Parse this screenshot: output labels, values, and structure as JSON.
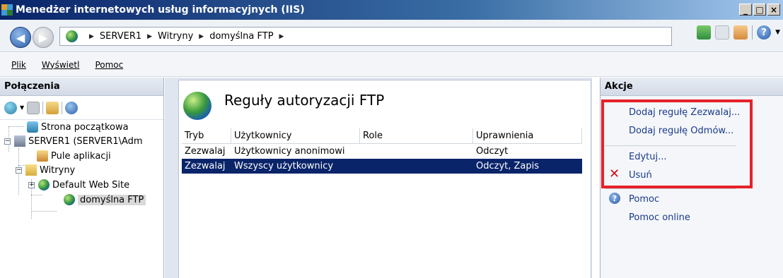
{
  "window": {
    "title": "Menedżer internetowych usług informacyjnych (IIS)",
    "buttons": [
      "_",
      "□",
      "×"
    ]
  },
  "address": {
    "breadcrumbs": [
      "SERVER1",
      "Witryny",
      "domyślna FTP"
    ]
  },
  "menu": {
    "items": [
      "Plik",
      "Wyświetl",
      "Pomoc"
    ]
  },
  "connections": {
    "header": "Połączenia",
    "tree": [
      {
        "label": "Strona początkowa",
        "icon": "home-icon"
      },
      {
        "label": "SERVER1 (SERVER1\\Adm",
        "icon": "server-icon",
        "expander": "−"
      },
      {
        "label": "Pule aplikacji",
        "icon": "app-pool-icon"
      },
      {
        "label": "Witryny",
        "icon": "folder-icon",
        "expander": "−"
      },
      {
        "label": "Default Web Site",
        "icon": "globe-icon",
        "expander": "+"
      },
      {
        "label": "domyślna FTP",
        "icon": "globe-icon",
        "selected": true
      }
    ]
  },
  "center": {
    "title": "Reguły autoryzacji FTP",
    "columns": [
      "Tryb",
      "Użytkownicy",
      "Role",
      "Uprawnienia"
    ],
    "rows": [
      {
        "tryb": "Zezwalaj",
        "uzytkownicy": "Użytkownicy anonimowi",
        "role": "",
        "uprawnienia": "Odczyt",
        "selected": false
      },
      {
        "tryb": "Zezwalaj",
        "uzytkownicy": "Wszyscy użytkownicy",
        "role": "",
        "uprawnienia": "Odczyt, Zapis",
        "selected": true
      }
    ]
  },
  "actions": {
    "header": "Akcje",
    "add_allow": "Dodaj regułę Zezwalaj...",
    "add_deny": "Dodaj regułę Odmów...",
    "edit": "Edytuj...",
    "delete": "Usuń",
    "help": "Pomoc",
    "help_online": "Pomoc online"
  },
  "colors": {
    "highlight_box": "#e8202a",
    "selection": "#0a246a",
    "action_link": "#1a3a8c"
  }
}
